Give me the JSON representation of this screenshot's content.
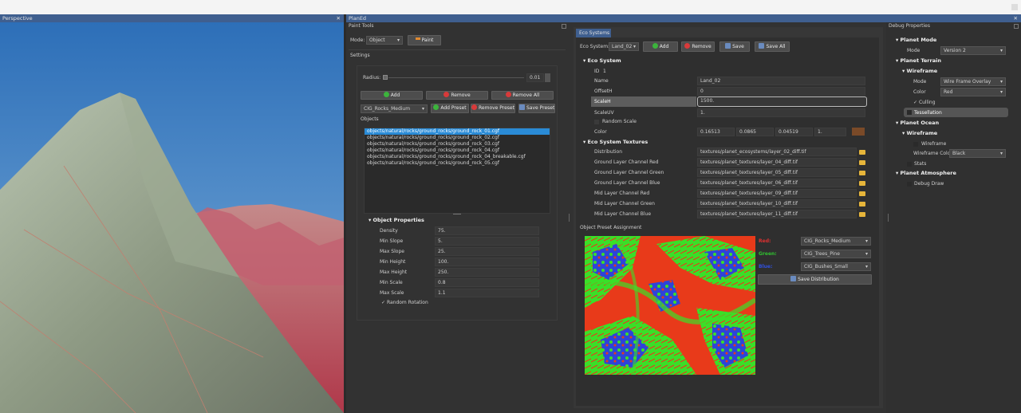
{
  "viewport": {
    "title": "Perspective"
  },
  "planed": {
    "title": "PlanEd",
    "paint_tools": {
      "title": "Paint Tools",
      "mode_label": "Mode:",
      "mode_value": "Object",
      "paint_button": "Paint",
      "settings_label": "Settings",
      "radius_label": "Radius:",
      "radius_value": "0.01",
      "add_button": "Add",
      "remove_button": "Remove",
      "remove_all_button": "Remove All",
      "preset_value": "CIG_Rocks_Medium",
      "add_preset_button": "Add Preset",
      "remove_preset_button": "Remove Preset",
      "save_preset_button": "Save Preset",
      "objects_label": "Objects",
      "objects": [
        "objects/natural/rocks/ground_rocks/ground_rock_01.cgf",
        "objects/natural/rocks/ground_rocks/ground_rock_02.cgf",
        "objects/natural/rocks/ground_rocks/ground_rock_03.cgf",
        "objects/natural/rocks/ground_rocks/ground_rock_04.cgf",
        "objects/natural/rocks/ground_rocks/ground_rock_04_breakable.cgf",
        "objects/natural/rocks/ground_rocks/ground_rock_05.cgf"
      ],
      "object_properties_header": "Object Properties",
      "object_properties": [
        {
          "label": "Density",
          "value": "75."
        },
        {
          "label": "Min Slope",
          "value": "5."
        },
        {
          "label": "Max Slope",
          "value": "25."
        },
        {
          "label": "Min Height",
          "value": "100."
        },
        {
          "label": "Max Height",
          "value": "250."
        },
        {
          "label": "Min Scale",
          "value": "0.8"
        },
        {
          "label": "Max Scale",
          "value": "1.1"
        }
      ],
      "random_rotation_label": "Random Rotation"
    },
    "eco_systems": {
      "tab": "Eco Systems",
      "eco_system_label": "Eco System:",
      "eco_system_value": "Land_02",
      "add_button": "Add",
      "remove_button": "Remove",
      "save_button": "Save",
      "save_all_button": "Save All",
      "eco_system_header": "Eco System",
      "id_label": "ID",
      "id_value": "1",
      "rows": [
        {
          "label": "Name",
          "value": "Land_02"
        },
        {
          "label": "OffsetH",
          "value": "0"
        },
        {
          "label": "ScaleH",
          "value": "1500."
        },
        {
          "label": "ScaleUV",
          "value": "1."
        }
      ],
      "random_scale_label": "Random Scale",
      "color_label": "Color",
      "color_values": [
        "0.16513",
        "0.0865",
        "0.04519",
        "1."
      ],
      "color_swatch": "#7a4a28",
      "textures_header": "Eco System Textures",
      "textures": [
        {
          "label": "Distribution",
          "value": "textures/planet_ecosystems/layer_02_diff.tif"
        },
        {
          "label": "Ground Layer Channel Red",
          "value": "textures/planet_textures/layer_04_diff.tif"
        },
        {
          "label": "Ground Layer Channel Green",
          "value": "textures/planet_textures/layer_05_diff.tif"
        },
        {
          "label": "Ground Layer Channel Blue",
          "value": "textures/planet_textures/layer_06_diff.tif"
        },
        {
          "label": "Mid Layer Channel Red",
          "value": "textures/planet_textures/layer_09_diff.tif"
        },
        {
          "label": "Mid Layer Channel Green",
          "value": "textures/planet_textures/layer_10_diff.tif"
        },
        {
          "label": "Mid Layer Channel Blue",
          "value": "textures/planet_textures/layer_11_diff.tif"
        }
      ],
      "preset_assignment_label": "Object Preset Assignment",
      "assign": [
        {
          "channel": "Red:",
          "color": "#e03030",
          "value": "CIG_Rocks_Medium"
        },
        {
          "channel": "Green:",
          "color": "#30c030",
          "value": "CIG_Trees_Pine"
        },
        {
          "channel": "Blue:",
          "color": "#3050e0",
          "value": "CIG_Bushes_Small"
        }
      ],
      "save_distribution_button": "Save Distribution"
    }
  },
  "debug": {
    "title": "Debug Properties",
    "planet_mode_header": "Planet Mode",
    "mode_label": "Mode",
    "mode_value": "Version 2",
    "planet_terrain_header": "Planet Terrain",
    "wireframe_header": "Wireframe",
    "wf_mode_label": "Mode",
    "wf_mode_value": "Wire Frame Overlay",
    "wf_color_label": "Color",
    "wf_color_value": "Red",
    "culling_label": "Culling",
    "tessellation_label": "Tessellation",
    "planet_ocean_header": "Planet Ocean",
    "ocean_wireframe_header": "Wireframe",
    "ocean_wireframe_label": "Wireframe",
    "wireframe_color_label": "Wireframe Color",
    "wireframe_color_value": "Black",
    "stats_label": "Stats",
    "planet_atmosphere_header": "Planet Atmosphere",
    "debug_draw_label": "Debug Draw"
  }
}
